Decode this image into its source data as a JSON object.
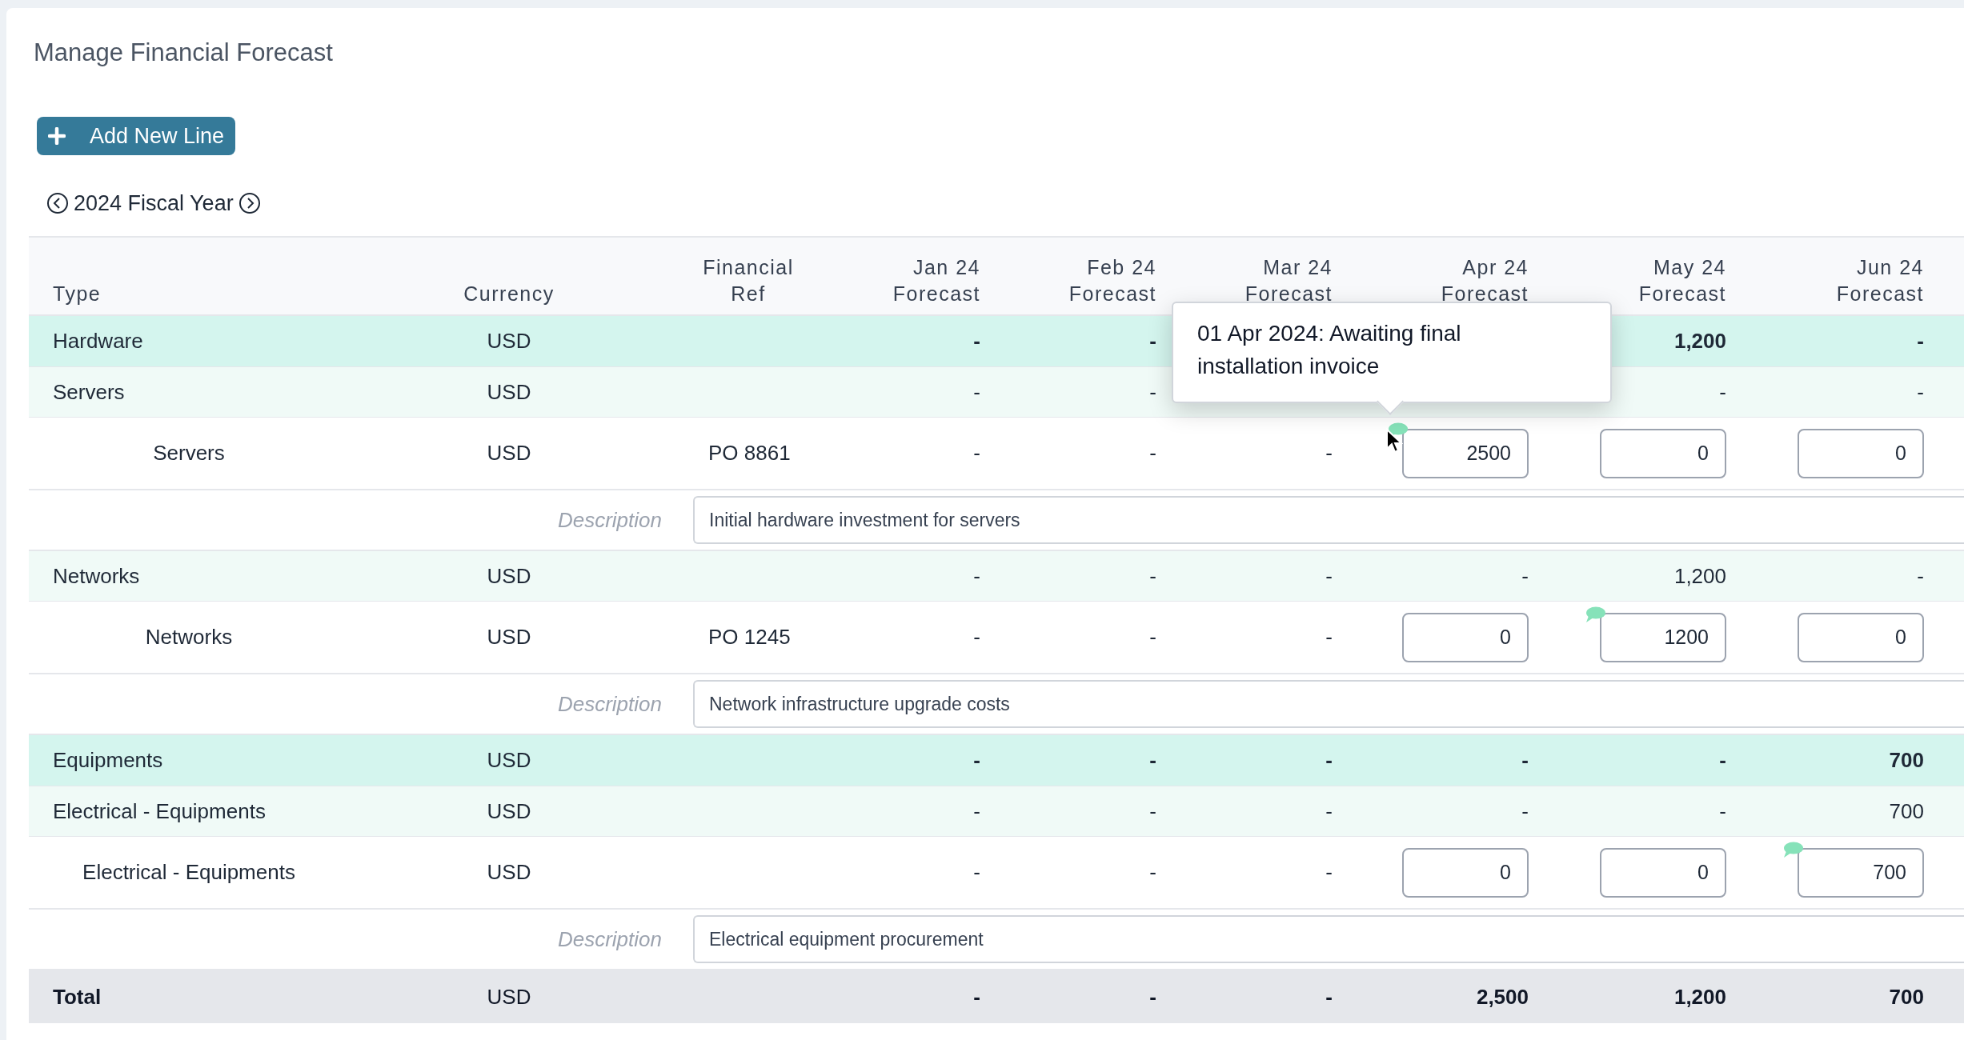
{
  "title": "Manage Financial Forecast",
  "add_button": {
    "label": "Add New Line"
  },
  "fiscal_year": {
    "label": "2024 Fiscal Year"
  },
  "table": {
    "columns": [
      {
        "lines": [
          "Type"
        ]
      },
      {
        "lines": [
          "Currency"
        ]
      },
      {
        "lines": [
          "Financial",
          "Ref"
        ]
      },
      {
        "lines": [
          "Jan 24",
          "Forecast"
        ]
      },
      {
        "lines": [
          "Feb 24",
          "Forecast"
        ]
      },
      {
        "lines": [
          "Mar 24",
          "Forecast"
        ]
      },
      {
        "lines": [
          "Apr 24",
          "Forecast"
        ]
      },
      {
        "lines": [
          "May 24",
          "Forecast"
        ]
      },
      {
        "lines": [
          "Jun 24",
          "Forecast"
        ]
      }
    ],
    "rows": [
      {
        "kind": "category",
        "type": "Hardware",
        "currency": "USD",
        "months": [
          {
            "kind": "text",
            "value": "-"
          },
          {
            "kind": "text",
            "value": "-"
          },
          {
            "kind": "covered"
          },
          {
            "kind": "covered"
          },
          {
            "kind": "text",
            "value": "1,200"
          },
          {
            "kind": "text",
            "value": "-"
          }
        ]
      },
      {
        "kind": "subcategory",
        "type": "Servers",
        "currency": "USD",
        "months": [
          {
            "kind": "text",
            "value": "-"
          },
          {
            "kind": "text",
            "value": "-"
          },
          {
            "kind": "covered"
          },
          {
            "kind": "covered"
          },
          {
            "kind": "text",
            "value": "-"
          },
          {
            "kind": "text",
            "value": "-"
          }
        ]
      },
      {
        "kind": "line",
        "type": "Servers",
        "currency": "USD",
        "ref": "PO 8861",
        "months": [
          {
            "kind": "text",
            "value": "-"
          },
          {
            "kind": "text",
            "value": "-"
          },
          {
            "kind": "text",
            "value": "-"
          },
          {
            "kind": "input",
            "value": "2500",
            "comment": true
          },
          {
            "kind": "input",
            "value": "0",
            "comment": false
          },
          {
            "kind": "input",
            "value": "0",
            "comment": false
          }
        ]
      },
      {
        "kind": "description",
        "label": "Description",
        "value": "Initial hardware investment for servers"
      },
      {
        "kind": "subcategory",
        "type": "Networks",
        "currency": "USD",
        "months": [
          {
            "kind": "text",
            "value": "-"
          },
          {
            "kind": "text",
            "value": "-"
          },
          {
            "kind": "text",
            "value": "-"
          },
          {
            "kind": "text",
            "value": "-"
          },
          {
            "kind": "text",
            "value": "1,200"
          },
          {
            "kind": "text",
            "value": "-"
          }
        ]
      },
      {
        "kind": "line",
        "type": "Networks",
        "currency": "USD",
        "ref": "PO 1245",
        "months": [
          {
            "kind": "text",
            "value": "-"
          },
          {
            "kind": "text",
            "value": "-"
          },
          {
            "kind": "text",
            "value": "-"
          },
          {
            "kind": "input",
            "value": "0",
            "comment": false
          },
          {
            "kind": "input",
            "value": "1200",
            "comment": true
          },
          {
            "kind": "input",
            "value": "0",
            "comment": false
          }
        ]
      },
      {
        "kind": "description",
        "label": "Description",
        "value": "Network infrastructure upgrade costs"
      },
      {
        "kind": "category",
        "type": "Equipments",
        "currency": "USD",
        "months": [
          {
            "kind": "text",
            "value": "-"
          },
          {
            "kind": "text",
            "value": "-"
          },
          {
            "kind": "text",
            "value": "-"
          },
          {
            "kind": "text",
            "value": "-"
          },
          {
            "kind": "text",
            "value": "-"
          },
          {
            "kind": "text",
            "value": "700"
          }
        ]
      },
      {
        "kind": "subcategory",
        "type": "Electrical - Equipments",
        "currency": "USD",
        "months": [
          {
            "kind": "text",
            "value": "-"
          },
          {
            "kind": "text",
            "value": "-"
          },
          {
            "kind": "text",
            "value": "-"
          },
          {
            "kind": "text",
            "value": "-"
          },
          {
            "kind": "text",
            "value": "-"
          },
          {
            "kind": "text",
            "value": "700"
          }
        ]
      },
      {
        "kind": "line",
        "type": "Electrical - Equipments",
        "currency": "USD",
        "months": [
          {
            "kind": "text",
            "value": "-"
          },
          {
            "kind": "text",
            "value": "-"
          },
          {
            "kind": "text",
            "value": "-"
          },
          {
            "kind": "input",
            "value": "0",
            "comment": false
          },
          {
            "kind": "input",
            "value": "0",
            "comment": false
          },
          {
            "kind": "input",
            "value": "700",
            "comment": true
          }
        ]
      },
      {
        "kind": "description",
        "label": "Description",
        "value": "Electrical equipment procurement"
      },
      {
        "kind": "total",
        "type": "Total",
        "currency": "USD",
        "months": [
          {
            "kind": "text",
            "value": "-"
          },
          {
            "kind": "text",
            "value": "-"
          },
          {
            "kind": "text",
            "value": "-"
          },
          {
            "kind": "text",
            "value": "2,500"
          },
          {
            "kind": "text",
            "value": "1,200"
          },
          {
            "kind": "text",
            "value": "700"
          }
        ]
      }
    ]
  },
  "tooltip": {
    "text": "01 Apr 2024: Awaiting final installation invoice"
  }
}
